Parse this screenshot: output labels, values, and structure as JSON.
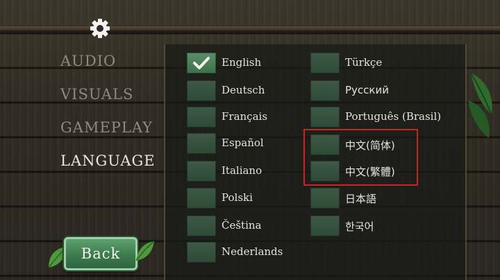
{
  "settings_icon": "gear-icon",
  "nav": {
    "items": [
      {
        "label": "AUDIO",
        "active": false
      },
      {
        "label": "VISUALS",
        "active": false
      },
      {
        "label": "GAMEPLAY",
        "active": false
      },
      {
        "label": "LANGUAGE",
        "active": true
      }
    ]
  },
  "languages": {
    "left": [
      {
        "label": "English",
        "selected": true
      },
      {
        "label": "Deutsch",
        "selected": false
      },
      {
        "label": "Français",
        "selected": false
      },
      {
        "label": "Español",
        "selected": false
      },
      {
        "label": "Italiano",
        "selected": false
      },
      {
        "label": "Polski",
        "selected": false
      },
      {
        "label": "Čeština",
        "selected": false
      },
      {
        "label": "Nederlands",
        "selected": false
      }
    ],
    "right": [
      {
        "label": "Türkçe",
        "selected": false
      },
      {
        "label": "Русский",
        "selected": false
      },
      {
        "label": "Português (Brasil)",
        "selected": false
      },
      {
        "label": "中文(简体)",
        "selected": false
      },
      {
        "label": "中文(繁體)",
        "selected": false
      },
      {
        "label": "日本語",
        "selected": false
      },
      {
        "label": "한국어",
        "selected": false
      }
    ]
  },
  "back_button": {
    "label": "Back"
  },
  "colors": {
    "checkbox": "#2d4a36",
    "checkbox_checked": "#4f8a5c",
    "highlight_border": "#d11f24",
    "active_nav": "#e8e6df",
    "inactive_nav": "#8d8a82"
  }
}
